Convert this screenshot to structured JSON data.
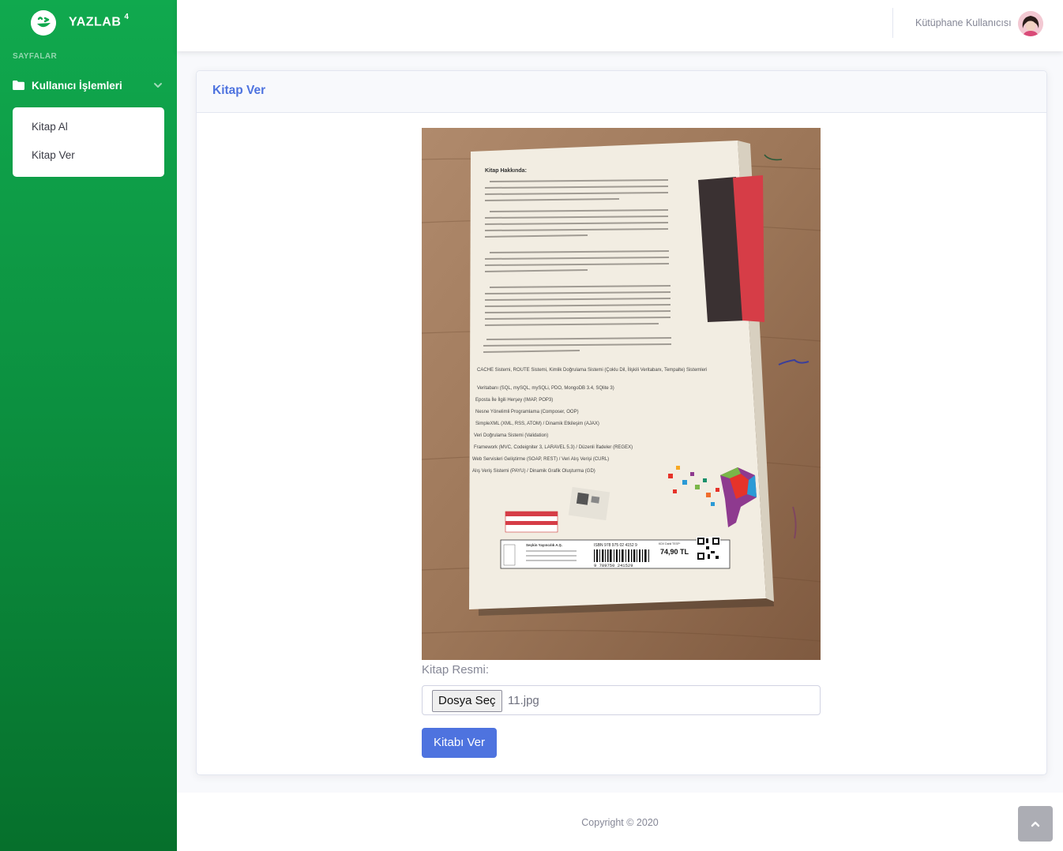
{
  "brand": {
    "name": "YAZLAB",
    "version": "4"
  },
  "sidebar": {
    "heading": "SAYFALAR",
    "section_label": "Kullanıcı İşlemleri",
    "items": [
      {
        "label": "Kitap Al"
      },
      {
        "label": "Kitap Ver"
      }
    ]
  },
  "topbar": {
    "user_name": "Kütüphane Kullanıcısı"
  },
  "card": {
    "title": "Kitap Ver",
    "image_label": "Kitap Resmi:",
    "file_button_label": "Dosya Seç",
    "file_name": "11.jpg",
    "submit_label": "Kitabı Ver"
  },
  "book_cover": {
    "heading": "Kitap Hakkında:",
    "bullets": [
      "CACHE Sistemi, ROUTE Sistemi, Kimlik Doğrulama Sistemi (Çoklu Dil, İlişkili Veritabanı, Tempalte) Sistemleri",
      "Veritabanı (SQL, mySQL, mySQLi, PDO, MongoDB 3.4, SQlite 3)",
      "Eposta İle İlgili Herşey (IMAP, POP3)",
      "Nesne Yönelimli Programlama (Composer, OOP)",
      "SimpleXML (XML, RSS, ATOM) / Dinamik Etkileşim (AJAX)",
      "Veri Doğrulama Sistemi (Validation)",
      "Framework (MVC, Codeigniter 3, LARAVEL 5.3) / Düzenli İfadeler (REGEX)",
      "Web Servisleri Geliştirme (SOAP, REST) / Veri Alış Verişi (CURL)",
      "Alış Veriş Sistemi (PAYU) / Dinamik Grafik Oluşturma (GD)"
    ],
    "isbn": "ISBN 978 975 02 4152 9",
    "price": "74,90 TL",
    "tax_note": "KDV Dahil TESF*",
    "barcode_number": "9 789750 241529",
    "publisher": "Seçkin Yayıncılık A.Ş."
  },
  "footer": {
    "copyright": "Copyright © 2020"
  },
  "colors": {
    "sidebar_green": "#10a94e",
    "primary": "#4e73df",
    "text_muted": "#858796"
  },
  "icons": {
    "brand": "laughing-face-icon",
    "folder": "folder-icon",
    "chevron": "chevron-down-icon",
    "scroll_top": "chevron-up-icon"
  }
}
